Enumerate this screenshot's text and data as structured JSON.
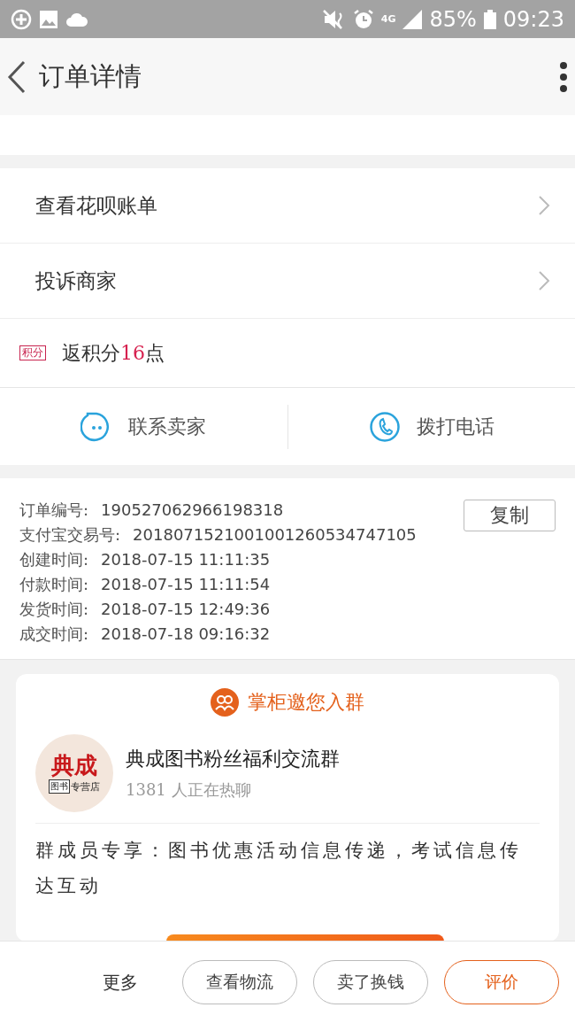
{
  "status_bar": {
    "battery": "85%",
    "time": "09:23",
    "network": "4G"
  },
  "header": {
    "title": "订单详情"
  },
  "menu_rows": [
    {
      "label": "查看花呗账单"
    },
    {
      "label": "投诉商家"
    }
  ],
  "points": {
    "badge": "积分",
    "text": "返积分**16**点"
  },
  "contact_actions": [
    {
      "kind": "chat",
      "label": "联系卖家"
    },
    {
      "kind": "phone",
      "label": "拨打电话"
    }
  ],
  "order_info": {
    "copy_button": "复制",
    "fields": [
      {
        "label": "订单编号:",
        "value": "190527062966198318"
      },
      {
        "label": "支付宝交易号:",
        "value": "2018071521001001260534747105"
      },
      {
        "label": "创建时间:",
        "value": "2018-07-15 11:11:35"
      },
      {
        "label": "付款时间:",
        "value": "2018-07-15 11:11:54"
      },
      {
        "label": "发货时间:",
        "value": "2018-07-15 12:49:36"
      },
      {
        "label": "成交时间:",
        "value": "2018-07-18 09:16:32"
      }
    ]
  },
  "group_card": {
    "title": "掌柜邀您入群",
    "logo": {
      "main": "典成",
      "box": "图书",
      "tail": "专营店"
    },
    "name": "典成图书粉丝福利交流群",
    "members": "1381 人正在热聊",
    "description": "群成员专享：图书优惠活动信息传递，考试信息传达互动"
  },
  "bottom_bar": {
    "more": "更多",
    "buttons": [
      {
        "label": "查看物流",
        "primary": false
      },
      {
        "label": "卖了换钱",
        "primary": false
      },
      {
        "label": "评价",
        "primary": true
      }
    ]
  }
}
